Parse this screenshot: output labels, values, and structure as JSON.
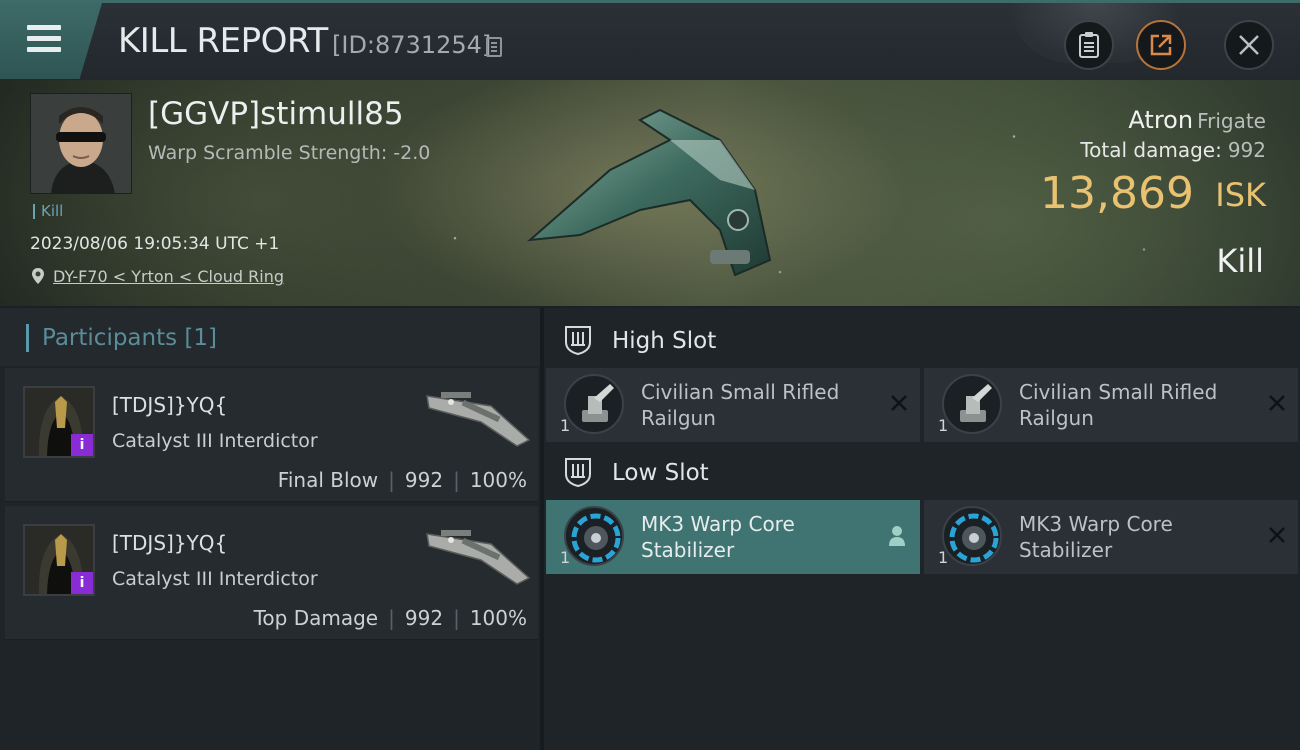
{
  "header": {
    "title": "KILL REPORT",
    "report_id": "[ID:8731254]",
    "icons": [
      "menu-icon",
      "copy-icon",
      "clipboard-icon",
      "share-icon",
      "close-icon"
    ]
  },
  "victim": {
    "name": "[GGVP]stimull85",
    "warp_scramble": "Warp Scramble Strength: -2.0",
    "tag": "Kill",
    "timestamp": "2023/08/06 19:05:34 UTC +1",
    "location": "DY-F70 < Yrton < Cloud Ring",
    "ship_name": "Atron",
    "ship_class": "Frigate",
    "total_damage_label": "Total damage:",
    "total_damage": "992",
    "isk_value": "13,869",
    "isk_unit": "ISK",
    "result": "Kill"
  },
  "participants": {
    "title": "Participants [1]",
    "items": [
      {
        "name": "[TDJS]}YQ{",
        "ship": "Catalyst III Interdictor",
        "role": "Final Blow",
        "damage": "992",
        "percent": "100%",
        "badge": "i"
      },
      {
        "name": "[TDJS]}YQ{",
        "ship": "Catalyst III Interdictor",
        "role": "Top Damage",
        "damage": "992",
        "percent": "100%",
        "badge": "i"
      }
    ]
  },
  "slots": {
    "high": {
      "title": "High Slot",
      "modules": [
        {
          "name": "Civilian Small Rifled Railgun",
          "qty": "1",
          "state": "destroyed"
        },
        {
          "name": "Civilian Small Rifled Railgun",
          "qty": "1",
          "state": "destroyed"
        }
      ]
    },
    "low": {
      "title": "Low Slot",
      "modules": [
        {
          "name": "MK3 Warp Core Stabilizer",
          "qty": "1",
          "state": "dropped"
        },
        {
          "name": "MK3 Warp Core Stabilizer",
          "qty": "1",
          "state": "destroyed"
        }
      ]
    }
  },
  "colors": {
    "accent_teal": "#3f7472",
    "isk_gold": "#e8c271",
    "participant_badge": "#8a2cd6",
    "header_tab": "#3d6a68"
  }
}
